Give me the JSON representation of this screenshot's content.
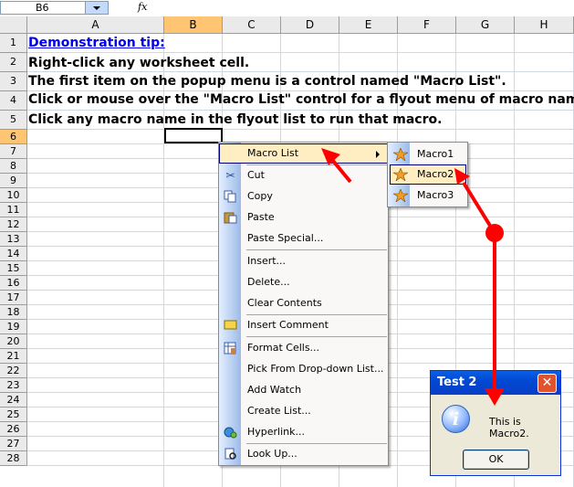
{
  "formula_bar": {
    "name_box": "B6",
    "fx_label": "fx"
  },
  "grid": {
    "columns": [
      "A",
      "B",
      "C",
      "D",
      "E",
      "F",
      "G",
      "H"
    ],
    "selected_column": "B",
    "rows": [
      "1",
      "2",
      "3",
      "4",
      "5",
      "6",
      "7",
      "8",
      "9",
      "10",
      "11",
      "12",
      "13",
      "14",
      "15",
      "16",
      "17",
      "18",
      "19",
      "20",
      "21",
      "22",
      "23",
      "24",
      "25",
      "26",
      "27",
      "28"
    ],
    "selected_row": "6"
  },
  "cells": {
    "a1": "Demonstration tip:",
    "a2": "Right-click any worksheet cell.",
    "a3": "The first item on the popup menu is a control named \"Macro List\".",
    "a4": "Click or mouse over the \"Macro List\" control for a flyout menu of macro names",
    "a5": "Click any macro name in the flyout list to run that macro."
  },
  "context_menu": {
    "items": [
      {
        "label": "Macro List",
        "icon": "none"
      },
      {
        "label": "Cut",
        "icon": "scissors-icon"
      },
      {
        "label": "Copy",
        "icon": "copy-icon"
      },
      {
        "label": "Paste",
        "icon": "paste-icon"
      },
      {
        "label": "Paste Special...",
        "icon": "none"
      },
      {
        "label": "Insert...",
        "icon": "none"
      },
      {
        "label": "Delete...",
        "icon": "none"
      },
      {
        "label": "Clear Contents",
        "icon": "none"
      },
      {
        "label": "Insert Comment",
        "icon": "comment-icon"
      },
      {
        "label": "Format Cells...",
        "icon": "format-cells-icon"
      },
      {
        "label": "Pick From Drop-down List...",
        "icon": "none"
      },
      {
        "label": "Add Watch",
        "icon": "none"
      },
      {
        "label": "Create List...",
        "icon": "none"
      },
      {
        "label": "Hyperlink...",
        "icon": "hyperlink-icon"
      },
      {
        "label": "Look Up...",
        "icon": "lookup-icon"
      }
    ]
  },
  "submenu": {
    "items": [
      {
        "label": "Macro1",
        "icon": "macro-icon"
      },
      {
        "label": "Macro2",
        "icon": "macro-icon"
      },
      {
        "label": "Macro3",
        "icon": "macro-icon"
      }
    ],
    "highlighted": "Macro2"
  },
  "dialog": {
    "title": "Test 2",
    "close_label": "✕",
    "info_glyph": "i",
    "message": "This is Macro2.",
    "ok_label": "OK"
  },
  "colors": {
    "highlight": "#ffeec2",
    "annotation": "#ff0000",
    "titlebar": "#0a5fe6"
  }
}
